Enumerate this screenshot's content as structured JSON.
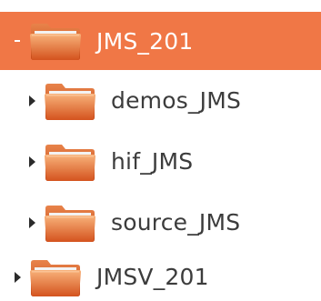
{
  "tree": {
    "root": {
      "label": "JMS_201",
      "expanded": true,
      "selected": true
    },
    "children": [
      {
        "label": "demos_JMS",
        "expanded": false
      },
      {
        "label": "hif_JMS",
        "expanded": false
      },
      {
        "label": "source_JMS",
        "expanded": false
      }
    ],
    "sibling": {
      "label": "JMSV_201",
      "expanded": false
    }
  },
  "colors": {
    "selection": "#f07746",
    "folder_top": "#f6a46a",
    "folder_bottom": "#d9541e",
    "text": "#3c3c3c",
    "selected_text": "#ffffff"
  },
  "icons": {
    "folder": "folder-icon",
    "expand": "expander-arrow-icon",
    "collapse": "expander-collapse-icon"
  }
}
